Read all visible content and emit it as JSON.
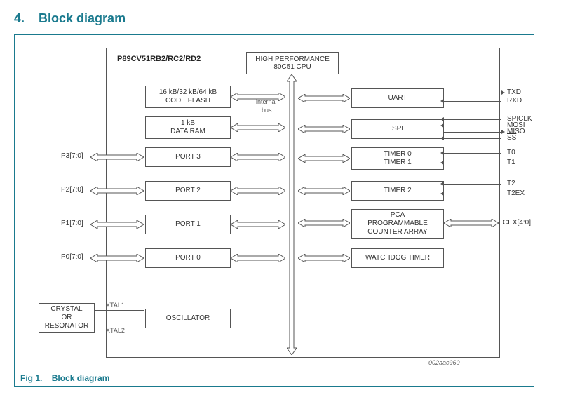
{
  "section": {
    "number": "4.",
    "title": "Block diagram"
  },
  "figure": {
    "label": "Fig 1.",
    "title": "Block diagram",
    "ref": "002aac960"
  },
  "chip": {
    "title": "P89CV51RB2/RC2/RD2"
  },
  "cpu": {
    "label": "HIGH PERFORMANCE\n80C51 CPU"
  },
  "bus": {
    "label1": "internal",
    "label2": "bus"
  },
  "left_blocks": {
    "flash": "16 kB/32 kB/64 kB\nCODE FLASH",
    "ram": "1 kB\nDATA RAM",
    "port3": "PORT 3",
    "port2": "PORT 2",
    "port1": "PORT 1",
    "port0": "PORT 0",
    "osc": "OSCILLATOR"
  },
  "right_blocks": {
    "uart": "UART",
    "spi": "SPI",
    "timer01": "TIMER 0\nTIMER 1",
    "timer2": "TIMER 2",
    "pca": "PCA\nPROGRAMMABLE\nCOUNTER ARRAY",
    "wdt": "WATCHDOG TIMER"
  },
  "ext_left": {
    "p3": "P3[7:0]",
    "p2": "P2[7:0]",
    "p1": "P1[7:0]",
    "p0": "P0[7:0]",
    "xtal1": "XTAL1",
    "xtal2": "XTAL2",
    "crystal": "CRYSTAL\nOR\nRESONATOR"
  },
  "ext_right": {
    "txd": "TXD",
    "rxd": "RXD",
    "spiclk": "SPICLK",
    "mosi": "MOSI",
    "miso": "MISO",
    "ss": "SS",
    "t0": "T0",
    "t1": "T1",
    "t2": "T2",
    "t2ex": "T2EX",
    "cex": "CEX[4:0]"
  }
}
